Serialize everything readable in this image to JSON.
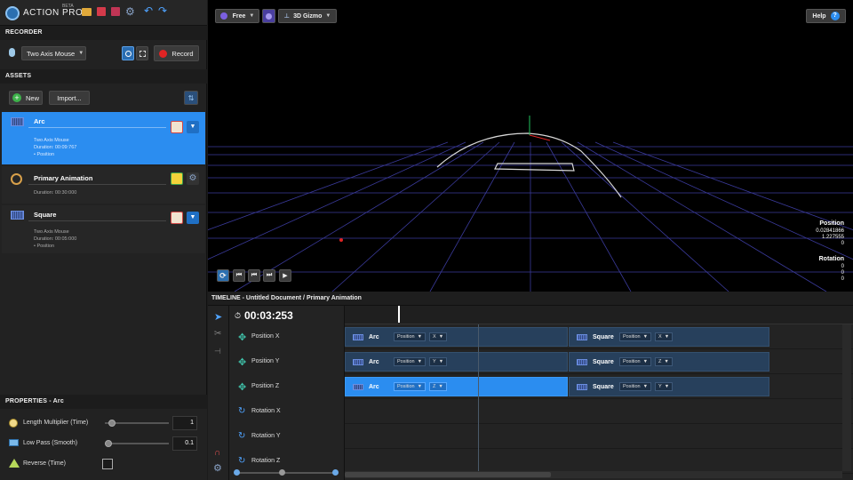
{
  "app": {
    "logo_text": "ACTION PRO",
    "badge": "BETA"
  },
  "recorder": {
    "header": "RECORDER",
    "device": "Two Axis Mouse",
    "record_label": "Record"
  },
  "assets": {
    "header": "ASSETS",
    "new_label": "New",
    "import_label": "Import...",
    "items": [
      {
        "name": "Arc",
        "lines": [
          "Two Axis Mouse",
          "Duration: 00:09:767",
          "• Position"
        ],
        "selected": true
      },
      {
        "name": "Primary Animation",
        "lines": [
          "Duration: 00:30:000"
        ],
        "selected": false
      },
      {
        "name": "Square",
        "lines": [
          "Two Axis Mouse",
          "Duration: 00:05:000",
          "• Position"
        ],
        "selected": false
      }
    ]
  },
  "properties": {
    "header": "PROPERTIES - Arc",
    "rows": [
      {
        "label": "Length Multiplier (Time)",
        "value": "1",
        "level": 0.05
      },
      {
        "label": "Low Pass (Smooth)",
        "value": "0.1",
        "level": 0.0
      },
      {
        "label": "Reverse (Time)",
        "checked": false
      }
    ]
  },
  "viewport": {
    "camera_mode": "Free",
    "gizmo_mode": "3D Gizmo",
    "help_label": "Help",
    "position": {
      "label": "Position",
      "values": [
        "0.02841866",
        "1.227555",
        "0"
      ]
    },
    "rotation": {
      "label": "Rotation",
      "values": [
        "0",
        "0",
        "0"
      ]
    }
  },
  "timeline": {
    "header": "TIMELINE - Untitled Document / Primary Animation",
    "time": "00:03:253",
    "tracks": [
      "Position X",
      "Position Y",
      "Position Z",
      "Rotation X",
      "Rotation Y",
      "Rotation Z"
    ],
    "clips": [
      [
        {
          "name": "Arc",
          "prop": "Position",
          "axis": "X",
          "sel": false
        },
        {
          "name": "Square",
          "prop": "Position",
          "axis": "X",
          "sel": false
        }
      ],
      [
        {
          "name": "Arc",
          "prop": "Position",
          "axis": "Y",
          "sel": false
        },
        {
          "name": "Square",
          "prop": "Position",
          "axis": "Z",
          "sel": false
        }
      ],
      [
        {
          "name": "Arc",
          "prop": "Position",
          "axis": "Z",
          "sel": true
        },
        {
          "name": "Square",
          "prop": "Position",
          "axis": "Y",
          "sel": false
        }
      ]
    ]
  },
  "colors": {
    "accent": "#2b8df0",
    "record": "#e02424",
    "clip": "#27405c",
    "gizmo_green": "#22c55e"
  }
}
